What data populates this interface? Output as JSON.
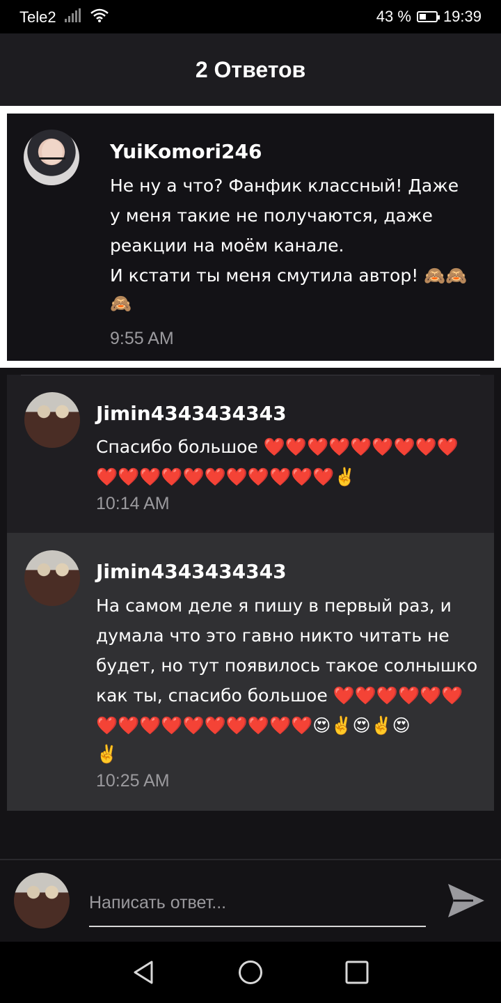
{
  "status_bar": {
    "carrier": "Tele2",
    "battery": "43 %",
    "battery_level": 0.43,
    "time": "19:39"
  },
  "header": {
    "title": "2 Ответов"
  },
  "parent_comment": {
    "username": "YuiKomori246",
    "lines": [
      "Не ну а что? Фанфик классный! Даже",
      "у меня такие не получаются, даже",
      "реакции на моём канале.",
      "И кстати ты меня смутила автор! 🙈🙈",
      "🙈"
    ],
    "time": "9:55 AM"
  },
  "replies": [
    {
      "username": "Jimin4343434343",
      "lines": [
        "Спасибо большое ❤️❤️❤️❤️❤️❤️❤️❤️❤️",
        "❤️❤️❤️❤️❤️❤️❤️❤️❤️❤️❤️✌️"
      ],
      "time": "10:14 AM"
    },
    {
      "username": "Jimin4343434343",
      "lines": [
        "На самом деле я пишу в первый раз, и",
        "думала что это гавно никто читать не",
        "будет, но тут появилось такое солнышко",
        "как ты, спасибо большое ❤️❤️❤️❤️❤️❤️",
        "❤️❤️❤️❤️❤️❤️❤️❤️❤️❤️😍✌️😍✌️😍",
        "✌️"
      ],
      "time": "10:25 AM"
    }
  ],
  "composer": {
    "placeholder": "Написать ответ..."
  },
  "icons": {
    "signal": "signal-icon",
    "wifi": "wifi-icon",
    "battery": "battery-icon",
    "send": "send-icon",
    "back": "back-triangle-icon",
    "home": "home-circle-icon",
    "recents": "recents-square-icon"
  },
  "colors": {
    "background": "#141316",
    "header": "#1d1c20",
    "reply_alt": "#303033",
    "timestamp": "#9b9a9e",
    "heart": "#e0242b"
  }
}
